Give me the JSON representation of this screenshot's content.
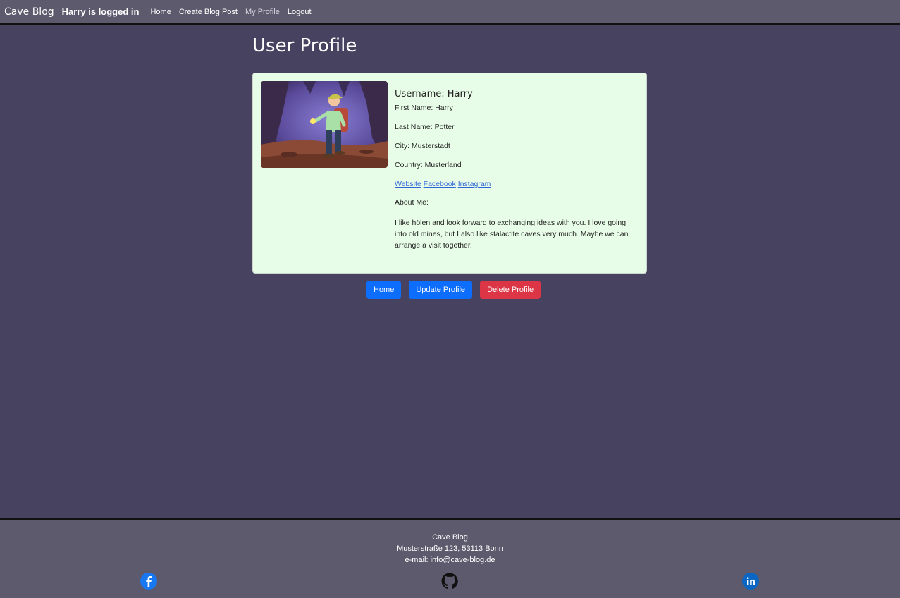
{
  "nav": {
    "brand": "Cave Blog",
    "login_status": "Harry is logged in",
    "links": [
      "Home",
      "Create Blog Post",
      "My Profile",
      "Logout"
    ]
  },
  "page": {
    "title": "User Profile"
  },
  "profile": {
    "username": "Username: Harry",
    "first_name": "First Name: Harry",
    "last_name": "Last Name: Potter",
    "city": "City: Musterstadt",
    "country": "Country: Musterland",
    "links": [
      "Website",
      "Facebook",
      "Instagram"
    ],
    "about_label": "About Me:",
    "about_text": "I like hölen and look forward to exchanging ideas with you. I love going into old mines, but I also like stalactite caves very much. Maybe we can arrange a visit together."
  },
  "actions": {
    "home": "Home",
    "update": "Update Profile",
    "delete": "Delete Profile"
  },
  "footer": {
    "name": "Cave Blog",
    "address": "Musterstraße 123, 53113 Bonn",
    "email": "e-mail: info@cave-blog.de",
    "social": [
      "facebook-icon",
      "github-icon",
      "linkedin-icon"
    ]
  },
  "colors": {
    "background": "#464260",
    "nav": "#5c5a6c",
    "card": "#e8fde8",
    "primary": "#0d6efd",
    "danger": "#dc3545",
    "link": "#2f66d6"
  }
}
